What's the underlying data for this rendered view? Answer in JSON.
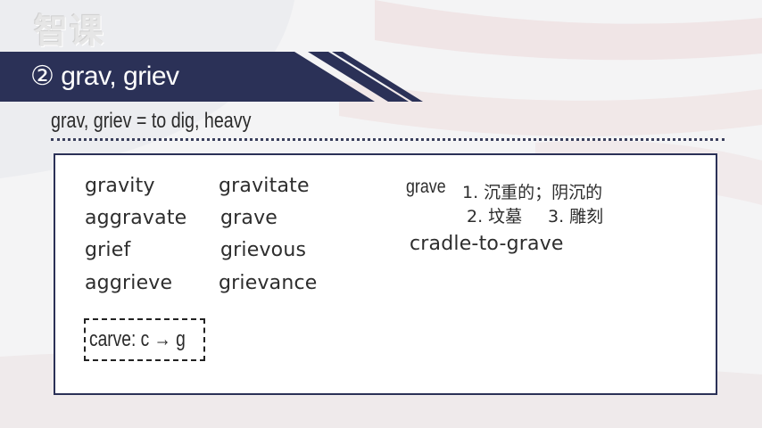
{
  "logo": "智课",
  "title": "② grav, griev",
  "definition": "grav, griev = to dig, heavy",
  "words": {
    "left": [
      "gravity",
      "aggravate",
      "grief",
      "aggrieve"
    ],
    "right": [
      "gravitate",
      "grave",
      "grievous",
      "grievance"
    ]
  },
  "grave_entry": {
    "headword": "grave",
    "sense_1": "1. 沉重的；阴沉的",
    "sense_2": "2. 坟墓",
    "sense_3": "3. 雕刻",
    "phrase": "cradle-to-grave"
  },
  "note": "carve: c → g",
  "colors": {
    "navy": "#2b3157",
    "border": "#2b3157"
  }
}
